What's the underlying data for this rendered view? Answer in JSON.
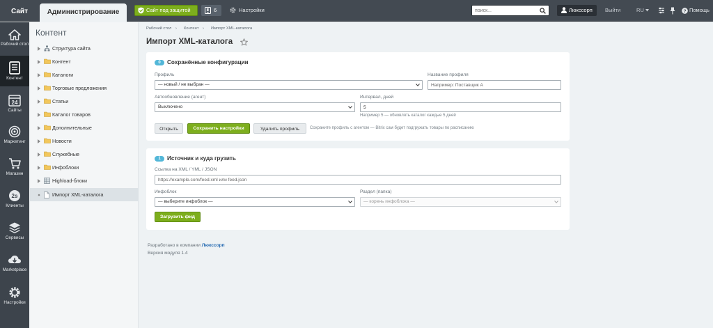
{
  "topbar": {
    "site_label": "Сайт",
    "admin_label": "Администрирование",
    "protected_label": "Сайт под защитой",
    "notifications_count": "6",
    "settings_label": "Настройки",
    "search_placeholder": "поиск...",
    "user_name": "Люксcорп",
    "logout_label": "Выйти",
    "lang_label": "RU",
    "help_label": "Помощь"
  },
  "leftnav": [
    {
      "label": "Рабочий стол",
      "icon": "home-icon"
    },
    {
      "label": "Контент",
      "icon": "content-icon"
    },
    {
      "label": "Сайты",
      "icon": "calendar-icon",
      "num": "24"
    },
    {
      "label": "Маркетинг",
      "icon": "target-icon"
    },
    {
      "label": "Магазин",
      "icon": "cart-icon"
    },
    {
      "label": "Клиенты",
      "icon": "clients-icon"
    },
    {
      "label": "Сервисы",
      "icon": "layers-icon"
    },
    {
      "label": "Marketplace",
      "icon": "download-icon"
    },
    {
      "label": "Настройки",
      "icon": "gear-icon"
    }
  ],
  "sidebar": {
    "title": "Контент",
    "items": [
      {
        "label": "Структура сайта",
        "icon": "sitemap-icon"
      },
      {
        "label": "Контент",
        "icon": "folder-icon"
      },
      {
        "label": "Каталоги",
        "icon": "folder-icon"
      },
      {
        "label": "Торговые предложения",
        "icon": "folder-icon"
      },
      {
        "label": "Статьи",
        "icon": "folder-icon"
      },
      {
        "label": "Каталог товаров",
        "icon": "folder-icon"
      },
      {
        "label": "Дополнительные",
        "icon": "folder-icon"
      },
      {
        "label": "Новости",
        "icon": "folder-icon"
      },
      {
        "label": "Служебные",
        "icon": "folder-icon"
      },
      {
        "label": "Инфоблоки",
        "icon": "folder-icon"
      },
      {
        "label": "Highload-блоки",
        "icon": "grid-icon"
      },
      {
        "label": "Импорт XML-каталога",
        "icon": "document-icon"
      }
    ]
  },
  "breadcrumb": [
    "Рабочий стол",
    "Контент",
    "Импорт XML-каталога"
  ],
  "page_title": "Импорт XML-каталога",
  "section1": {
    "number": "0",
    "title": "Сохранённые конфигурации",
    "profile_label": "Профиль",
    "profile_value": "— новый / не выбран —",
    "profile_name_label": "Название профиля",
    "profile_name_placeholder": "Например: Поставщик А",
    "autoupdate_label": "Автообновление (агент)",
    "autoupdate_value": "Выключено",
    "interval_label": "Интервал, дней",
    "interval_value": "5",
    "interval_hint": "Например 5 — обновлять каталог каждые 5 дней",
    "btn_open": "Открыть",
    "btn_save": "Сохранить настройки",
    "btn_delete": "Удалить профиль",
    "save_hint": "Сохраните профиль с агентом — Bitrix сам будет подгружать товары по расписанию"
  },
  "section2": {
    "number": "1",
    "title": "Источник и куда грузить",
    "url_label": "Ссылка на XML / YML / JSON",
    "url_placeholder": "https://example.com/feed.xml или feed.json",
    "iblock_label": "Инфоблок",
    "iblock_value": "— выберите инфоблок —",
    "section_label": "Раздел (папка)",
    "section_value": "— корень инфоблока —",
    "btn_load": "Загрузить фид"
  },
  "footer": {
    "developed_prefix": "Разработано в компании",
    "company": "Люксcорп",
    "version": "Версия модуля 1.4"
  },
  "colors": {
    "topbar": "#434a52",
    "leftnav": "#3d444c",
    "accent_green": "#7dae1d",
    "badge_blue": "#53b7d8",
    "page_bg": "#eef2f4"
  }
}
